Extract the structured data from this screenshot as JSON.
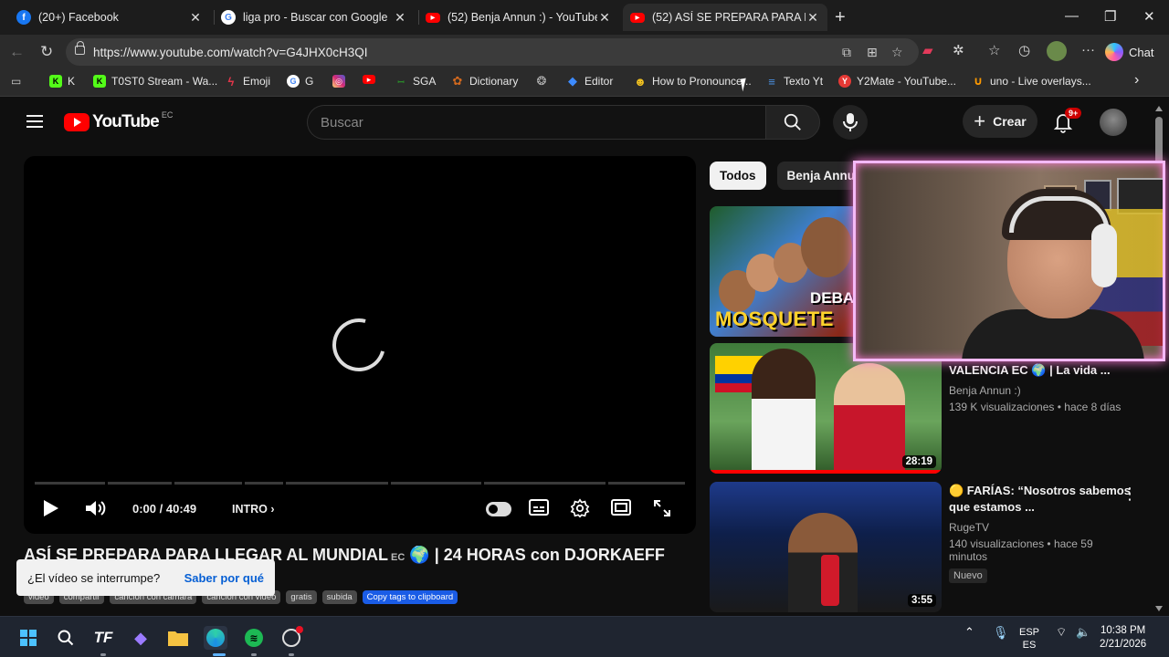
{
  "browser": {
    "tabs": [
      {
        "title": "(20+) Facebook",
        "icon": "facebook-icon",
        "color": "#1877f2"
      },
      {
        "title": "liga pro - Buscar con Google",
        "icon": "google-icon",
        "color": "#4285f4"
      },
      {
        "title": "(52) Benja Annun :) - YouTube",
        "icon": "youtube-icon",
        "color": "#ff0000"
      },
      {
        "title": "(52) ASÍ SE PREPARA PARA LLEGAR",
        "icon": "youtube-icon",
        "color": "#ff0000",
        "active": true
      }
    ],
    "url": "https://www.youtube.com/watch?v=G4JHX0cH3QI",
    "chat_label": "Chat",
    "bookmarks": [
      {
        "label": "K",
        "icon": "kick-icon",
        "color": "#53fc18"
      },
      {
        "label": "T0ST0 Stream - Wa...",
        "icon": "kick-icon",
        "color": "#53fc18"
      },
      {
        "label": "Emoji",
        "icon": "bolt-icon",
        "color": "#e2364a"
      },
      {
        "label": "G",
        "icon": "google-icon",
        "color": "#4285f4"
      },
      {
        "label": "",
        "icon": "instagram-icon",
        "color": "#d62976"
      },
      {
        "label": "",
        "icon": "youtube-icon",
        "color": "#ff0000"
      },
      {
        "label": "SGA",
        "icon": "sga-icon",
        "color": "#2a8a2a"
      },
      {
        "label": "Dictionary",
        "icon": "dictionary-icon",
        "color": "#d2691e"
      },
      {
        "label": "",
        "icon": "openai-icon",
        "color": "#9a9a9a"
      },
      {
        "label": "Editor",
        "icon": "editor-icon",
        "color": "#3d8bff"
      },
      {
        "label": "How to Pronounce...",
        "icon": "pronounce-icon",
        "color": "#f0c020"
      },
      {
        "label": "Texto Yt",
        "icon": "document-icon",
        "color": "#4a90e2"
      },
      {
        "label": "Y2Mate - YouTube...",
        "icon": "y2mate-icon",
        "color": "#e53935"
      },
      {
        "label": "uno - Live overlays...",
        "icon": "uno-icon",
        "color": "#ff9a00"
      }
    ]
  },
  "youtube": {
    "logo_text": "YouTube",
    "country_code": "EC",
    "search_placeholder": "Buscar",
    "create_label": "Crear",
    "notifications": "9+",
    "player": {
      "time": "0:00 / 40:49",
      "chapter": "INTRO"
    },
    "video_title": "ASÍ SE PREPARA PARA LLEGAR AL MUNDIAL",
    "video_title_suffix": "| 24 HORAS con DJORKAEFF",
    "title_flag": "EC",
    "tags": [
      "video",
      "compartir",
      "cancion con camara",
      "cancion con video",
      "gratis",
      "subida"
    ],
    "copy_tags_label": "Copy tags to clipboard",
    "toast": {
      "message": "¿El vídeo se interrumpe?",
      "link": "Saber por qué"
    },
    "chips": [
      "Todos",
      "Benja Annun"
    ],
    "recommendations": [
      {
        "thumb_text": "MOSQUETE",
        "thumb_text2": "DEBAT",
        "title": "",
        "channel": "",
        "views": ""
      },
      {
        "title": "VALENCIA EC 🌍 | La vida ...",
        "channel": "Benja Annun :)",
        "views": "139 K visualizaciones",
        "age": "hace 8 días",
        "duration": "28:19",
        "watched_fraction": 1.0
      },
      {
        "title": "🟡 FARÍAS: “Nosotros sabemos que estamos ...",
        "channel": "RugeTV",
        "views": "140 visualizaciones",
        "age": "hace 59 minutos",
        "badge": "Nuevo",
        "duration": "3:55"
      }
    ]
  },
  "taskbar": {
    "lang_top": "ESP",
    "lang_bottom": "ES",
    "time": "10:38 PM",
    "date": "2/21/2026"
  },
  "colors": {
    "yt_red": "#ff0000",
    "webcam_border": "#f4b9f7",
    "link_blue": "#065fd4"
  }
}
